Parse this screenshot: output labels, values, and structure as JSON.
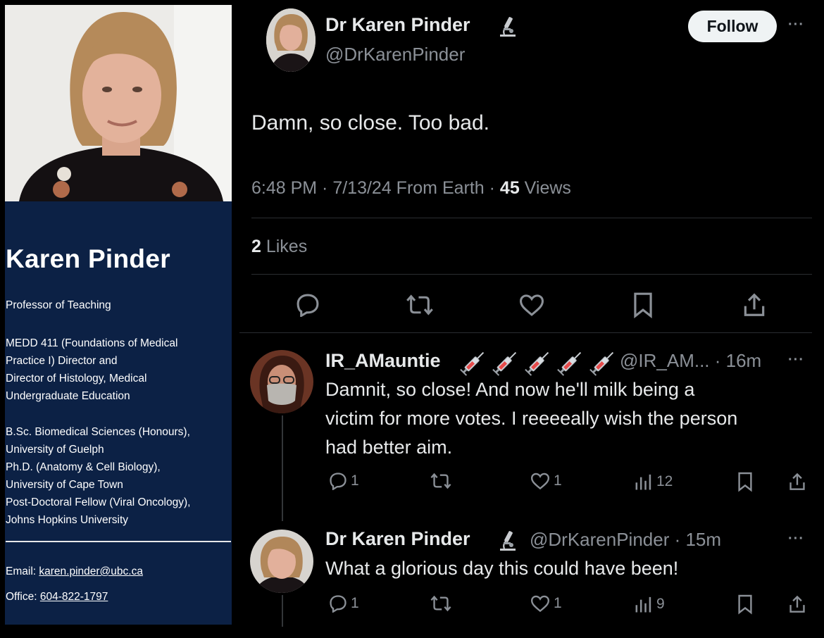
{
  "profile": {
    "name": "Karen Pinder",
    "title": "Professor of Teaching",
    "roles": [
      "MEDD 411 (Foundations of Medical",
      "Practice I) Director and",
      "Director of Histology, Medical",
      "Undergraduate Education"
    ],
    "education": [
      "B.Sc. Biomedical Sciences (Honours),",
      "University of Guelph",
      "Ph.D. (Anatomy & Cell Biology),",
      "University of Cape Town",
      "Post-Doctoral Fellow (Viral Oncology),",
      "Johns Hopkins University"
    ],
    "email_label": "Email: ",
    "email": "karen.pinder@ubc.ca",
    "office_label": "Office: ",
    "office": "604-822-1797"
  },
  "tweet": {
    "name": "Dr Karen Pinder",
    "badge_icon": "microscope-icon",
    "handle": "@DrKarenPinder",
    "follow_label": "Follow",
    "more": "···",
    "text": "Damn, so close. Too bad.",
    "time": "6:48 PM · 7/13/24 From Earth · ",
    "views_count": "45",
    "views_label": " Views",
    "likes_count": "2",
    "likes_label": " Likes"
  },
  "replies": [
    {
      "name": "IR_AMauntie",
      "badge_icon": "syringe-icon",
      "badge_count": 5,
      "handle": "@IR_AM... · 16m",
      "more": "···",
      "lines": [
        "Damnit, so close! And now he'll milk being a",
        "victim for more votes. I reeeeally wish the person",
        "had better aim."
      ],
      "replies": "1",
      "likes": "1",
      "views": "12"
    },
    {
      "name": "Dr Karen Pinder",
      "badge_icon": "microscope-icon",
      "handle": "@DrKarenPinder · 15m",
      "more": "···",
      "text": "What a glorious day this could have been!",
      "replies": "1",
      "likes": "1",
      "views": "9"
    }
  ],
  "colors": {
    "card_navy": "#0c2145",
    "background": "#000000",
    "muted_text": "#8b9097",
    "main_text": "#e7e9ea"
  }
}
